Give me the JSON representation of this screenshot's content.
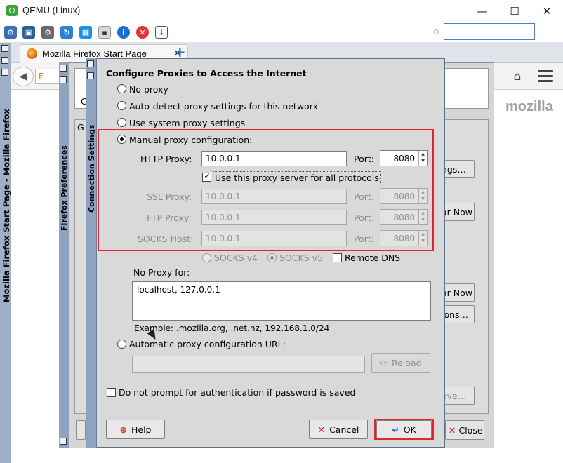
{
  "window": {
    "title": "QEMU (Linux)",
    "controls": {
      "minimize": "—",
      "maximize": "☐",
      "close": "✕"
    }
  },
  "toolbar": {
    "icons": [
      "settings-icon",
      "fullscreen-icon",
      "gear-icon",
      "refresh-icon",
      "windows-icon",
      "terminal-icon",
      "info-icon",
      "stop-icon",
      "download-icon"
    ],
    "search_value": ""
  },
  "firefox": {
    "side_title": "Mozilla Firefox Start Page - Mozilla Firefox",
    "tab_label": "Mozilla Firefox Start Page",
    "tab_close": "×",
    "new_tab": "+",
    "url_fragment": "F",
    "brand": "mozilla"
  },
  "prefs": {
    "side_title": "Firefox Preferences",
    "tab_fragment": "G",
    "fragment_c": "C",
    "buttons": {
      "settings": "ngs…",
      "clear_now_1": "ar Now",
      "clear_now_2": "ar Now",
      "exceptions": "ions…",
      "remove": "ove…",
      "close": "Close"
    }
  },
  "conn": {
    "side_title": "Connection Settings",
    "header": "Configure Proxies to Access the Internet",
    "options": {
      "no_proxy": "No proxy",
      "auto_detect": "Auto-detect proxy settings for this network",
      "system": "Use system proxy settings",
      "manual": "Manual proxy configuration:",
      "auto_url": "Automatic proxy configuration URL:"
    },
    "http_label": "HTTP Proxy:",
    "http_value": "10.0.0.1",
    "port_label": "Port:",
    "http_port": "8080",
    "use_all": "Use this proxy server for all protocols",
    "ssl_label": "SSL Proxy:",
    "ssl_value": "10.0.0.1",
    "ssl_port": "8080",
    "ftp_label": "FTP Proxy:",
    "ftp_value": "10.0.0.1",
    "ftp_port": "8080",
    "socks_label": "SOCKS Host:",
    "socks_value": "10.0.0.1",
    "socks_port": "8080",
    "socks_v4": "SOCKS v4",
    "socks_v5": "SOCKS v5",
    "remote_dns": "Remote DNS",
    "no_proxy_label": "No Proxy for:",
    "no_proxy_value": "localhost, 127.0.0.1",
    "example": "Example: .mozilla.org, .net.nz, 192.168.1.0/24",
    "auto_url_value": "",
    "reload": "Reload",
    "no_prompt": "Do not prompt for authentication if password is saved",
    "help": "Help",
    "cancel": "Cancel",
    "ok": "OK"
  },
  "colors": {
    "highlight": "#e2262e",
    "strip": "#8fa3c0",
    "dialog_bg": "#d9d9d9"
  }
}
